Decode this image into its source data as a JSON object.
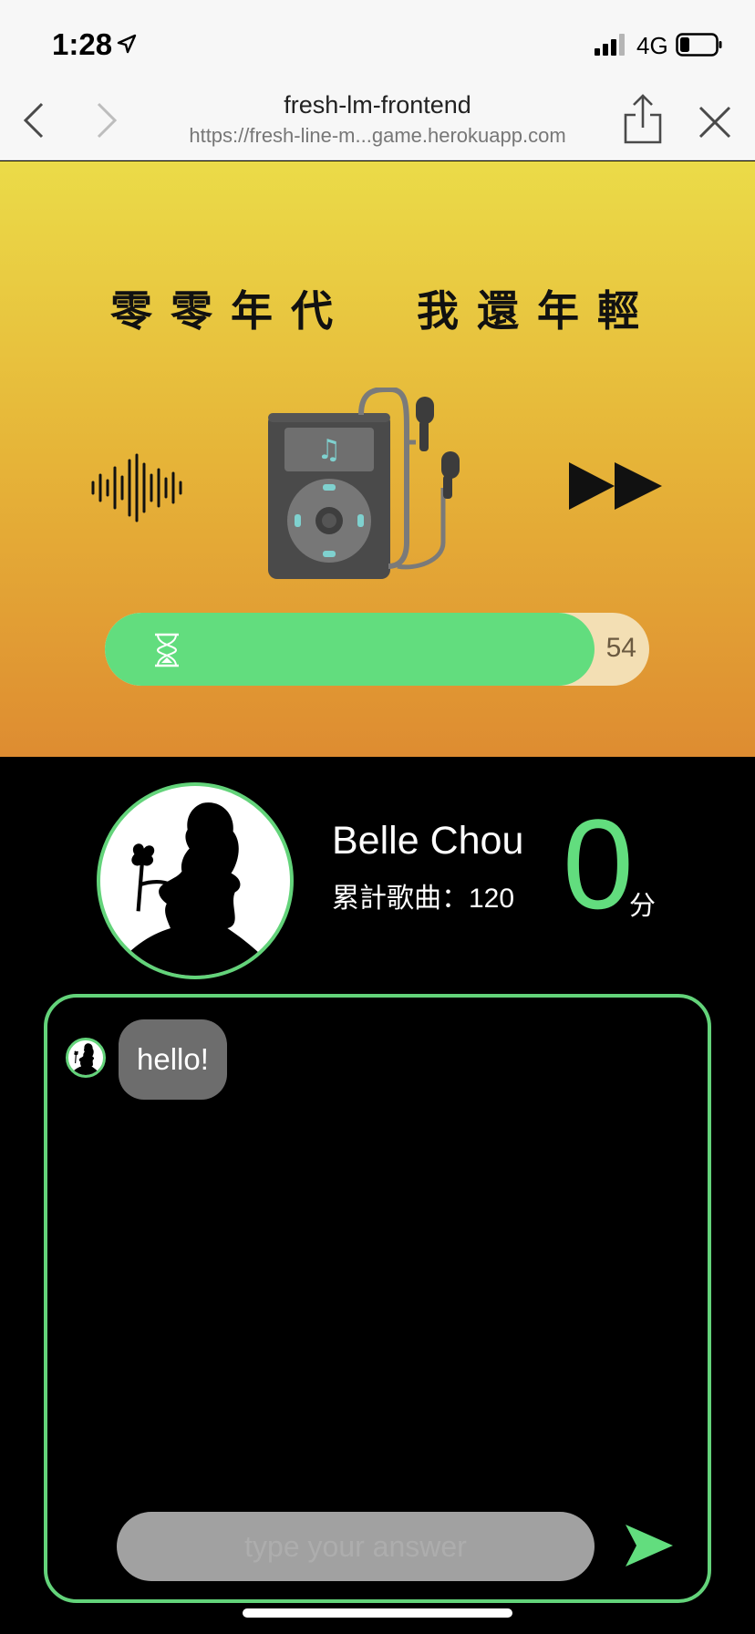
{
  "status_bar": {
    "time": "1:28",
    "network": "4G"
  },
  "browser": {
    "page_title": "fresh-lm-frontend",
    "url": "https://fresh-line-m...game.herokuapp.com"
  },
  "hero": {
    "title": "零零年代  我還年輕",
    "timer": {
      "remaining": "54",
      "progress": 0.9
    }
  },
  "profile": {
    "name": "Belle Chou",
    "song_count": "累計歌曲：120",
    "score": "0",
    "score_unit": "分"
  },
  "chat": {
    "messages": [
      {
        "text": "hello!"
      }
    ],
    "input_placeholder": "type your answer",
    "input_value": ""
  },
  "colors": {
    "accent_green": "#62dd7e",
    "hero_gradient_top": "#ebdb48",
    "hero_gradient_bottom": "#de8c31",
    "bubble": "#6d6d6d",
    "input": "#a1a1a1"
  },
  "icons": {
    "location": "location-arrow-icon",
    "signal": "cellular-signal-icon",
    "battery": "battery-icon",
    "back": "chevron-left-icon",
    "forward": "chevron-right-icon",
    "share": "share-icon",
    "close": "close-icon",
    "wave": "sound-wave-icon",
    "player": "mp3-player-icon",
    "fast_forward": "fast-forward-icon",
    "hourglass": "hourglass-icon",
    "send": "send-icon"
  }
}
